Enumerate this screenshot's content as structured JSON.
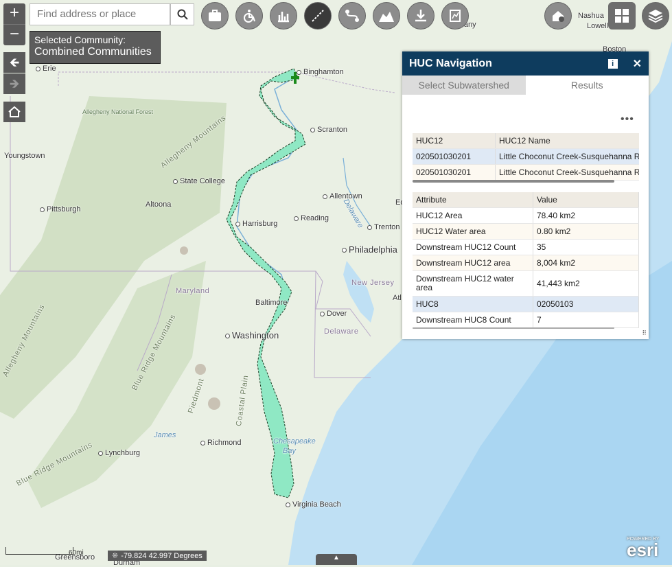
{
  "search": {
    "placeholder": "Find address or place"
  },
  "community": {
    "label": "Selected Community:",
    "value": "Combined Communities"
  },
  "zoom": {
    "in": "+",
    "out": "−"
  },
  "nav": {
    "back": "🡸",
    "forward": "🡺"
  },
  "toolbar": {
    "tools": [
      {
        "icon": "briefcase-icon"
      },
      {
        "icon": "wheelchair-icon"
      },
      {
        "icon": "chart-icon"
      },
      {
        "icon": "route-icon"
      },
      {
        "icon": "path-icon"
      },
      {
        "icon": "profile-icon",
        "label": "Profile"
      },
      {
        "icon": "download-icon"
      },
      {
        "icon": "graph-icon"
      }
    ]
  },
  "panel": {
    "title": "HUC Navigation",
    "tabs": [
      "Select Subwatershed",
      "Results"
    ],
    "selected_tab": "Results",
    "more": "•••",
    "huc_table": {
      "headers": [
        "HUC12",
        "HUC12 Name"
      ],
      "rows": [
        [
          "020501030201",
          "Little Choconut Creek-Susquehanna R"
        ],
        [
          "020501030201",
          "Little Choconut Creek-Susquehanna R"
        ]
      ]
    },
    "attr_table": {
      "headers": [
        "Attribute",
        "Value"
      ],
      "rows": [
        [
          "HUC12 Area",
          "78.40 km2"
        ],
        [
          "HUC12 Water area",
          "0.80 km2"
        ],
        [
          "Downstream HUC12 Count",
          "35"
        ],
        [
          "Downstream HUC12 area",
          "8,004 km2"
        ],
        [
          "Downstream HUC12 water area",
          "41,443 km2"
        ],
        [
          "HUC8",
          "02050103"
        ],
        [
          "Downstream HUC8 Count",
          "7"
        ]
      ]
    }
  },
  "map": {
    "cities": [
      "Binghamton",
      "Scranton",
      "Erie",
      "Youngstown",
      "State College",
      "Pittsburgh",
      "Altoona",
      "Harrisburg",
      "Allentown",
      "Reading",
      "Trenton",
      "Philadelphia",
      "Baltimore",
      "Dover",
      "Washington",
      "Richmond",
      "Lynchburg",
      "Virginia Beach",
      "Greensboro",
      "Durham",
      "Albany",
      "Nashua",
      "Lowell",
      "Boston",
      "Atl",
      "Ed"
    ],
    "states": [
      "New Jersey",
      "Maryland",
      "Delaware"
    ],
    "regions": [
      "Allegheny Mountains",
      "Allegheny Mountains",
      "Allegheny National Forest",
      "Blue Ridge Mountains",
      "Blue Ridge Mountains",
      "Piedmont",
      "Coastal Plain"
    ],
    "water": [
      "Delaware",
      "James",
      "Chesapeake",
      "Bay"
    ]
  },
  "scale_label": "60mi",
  "coordinates": "-79.824 42.997 Degrees",
  "esri": {
    "top": "POWERED BY",
    "brand": "esri"
  },
  "colors": {
    "header": "#0e3c5e",
    "watershed": "#8fe8c4",
    "button": "#5a5a5a"
  }
}
